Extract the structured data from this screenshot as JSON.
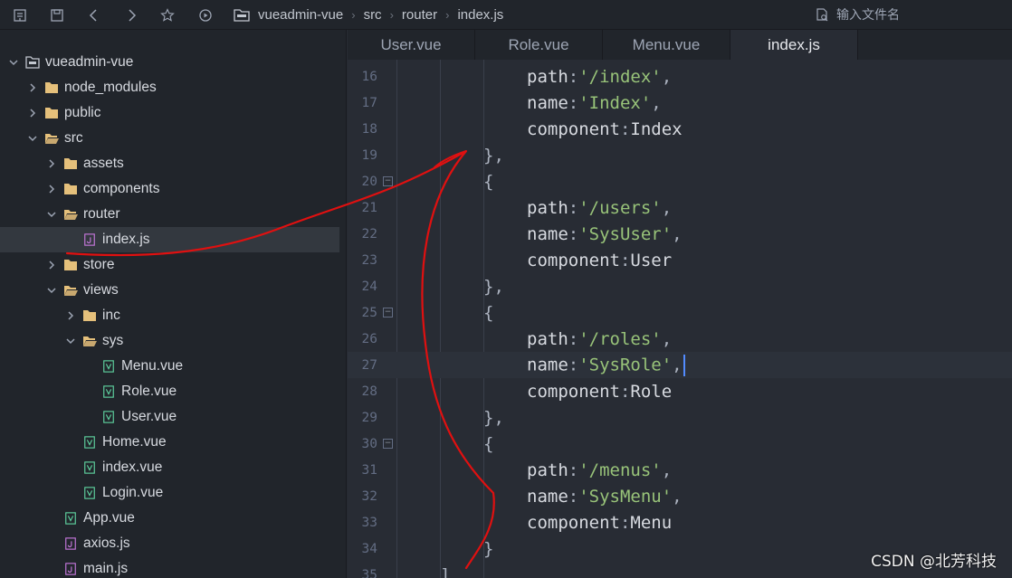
{
  "toolbar": {
    "icons": [
      "collapse-icon",
      "save-icon",
      "back-icon",
      "forward-icon",
      "star-icon",
      "run-icon"
    ]
  },
  "breadcrumb": {
    "items": [
      "vueadmin-vue",
      "src",
      "router",
      "index.js"
    ]
  },
  "file_search": {
    "placeholder": "输入文件名"
  },
  "tabs": [
    {
      "label": "User.vue",
      "active": false
    },
    {
      "label": "Role.vue",
      "active": false
    },
    {
      "label": "Menu.vue",
      "active": false
    },
    {
      "label": "index.js",
      "active": true
    }
  ],
  "tree": [
    {
      "label": "vueadmin-vue",
      "depth": 0,
      "type": "project",
      "expanded": true
    },
    {
      "label": "node_modules",
      "depth": 1,
      "type": "folder",
      "expanded": false
    },
    {
      "label": "public",
      "depth": 1,
      "type": "folder",
      "expanded": false
    },
    {
      "label": "src",
      "depth": 1,
      "type": "folder",
      "expanded": true
    },
    {
      "label": "assets",
      "depth": 2,
      "type": "folder",
      "expanded": false
    },
    {
      "label": "components",
      "depth": 2,
      "type": "folder",
      "expanded": false
    },
    {
      "label": "router",
      "depth": 2,
      "type": "folder",
      "expanded": true
    },
    {
      "label": "index.js",
      "depth": 3,
      "type": "js",
      "selected": true
    },
    {
      "label": "store",
      "depth": 2,
      "type": "folder",
      "expanded": false
    },
    {
      "label": "views",
      "depth": 2,
      "type": "folder",
      "expanded": true
    },
    {
      "label": "inc",
      "depth": 3,
      "type": "folder",
      "expanded": false
    },
    {
      "label": "sys",
      "depth": 3,
      "type": "folder",
      "expanded": true
    },
    {
      "label": "Menu.vue",
      "depth": 4,
      "type": "vue"
    },
    {
      "label": "Role.vue",
      "depth": 4,
      "type": "vue"
    },
    {
      "label": "User.vue",
      "depth": 4,
      "type": "vue"
    },
    {
      "label": "Home.vue",
      "depth": 3,
      "type": "vue"
    },
    {
      "label": "index.vue",
      "depth": 3,
      "type": "vue"
    },
    {
      "label": "Login.vue",
      "depth": 3,
      "type": "vue"
    },
    {
      "label": "App.vue",
      "depth": 2,
      "type": "vue"
    },
    {
      "label": "axios.js",
      "depth": 2,
      "type": "js"
    },
    {
      "label": "main.js",
      "depth": 2,
      "type": "js"
    }
  ],
  "code": [
    {
      "n": "16",
      "indent": 3,
      "tokens": [
        [
          "key",
          "path"
        ],
        [
          "pun",
          ":"
        ],
        [
          "str",
          "'/index'"
        ],
        [
          "pun",
          ","
        ]
      ]
    },
    {
      "n": "17",
      "indent": 3,
      "tokens": [
        [
          "key",
          "name"
        ],
        [
          "pun",
          ":"
        ],
        [
          "str",
          "'Index'"
        ],
        [
          "pun",
          ","
        ]
      ]
    },
    {
      "n": "18",
      "indent": 3,
      "tokens": [
        [
          "key",
          "component"
        ],
        [
          "pun",
          ":"
        ],
        [
          "id",
          "Index"
        ]
      ]
    },
    {
      "n": "19",
      "indent": 2,
      "tokens": [
        [
          "pun",
          "},"
        ]
      ]
    },
    {
      "n": "20",
      "indent": 2,
      "fold": true,
      "tokens": [
        [
          "pun",
          "{"
        ]
      ]
    },
    {
      "n": "21",
      "indent": 3,
      "tokens": [
        [
          "key",
          "path"
        ],
        [
          "pun",
          ":"
        ],
        [
          "str",
          "'/users'"
        ],
        [
          "pun",
          ","
        ]
      ]
    },
    {
      "n": "22",
      "indent": 3,
      "tokens": [
        [
          "key",
          "name"
        ],
        [
          "pun",
          ":"
        ],
        [
          "str",
          "'SysUser'"
        ],
        [
          "pun",
          ","
        ]
      ]
    },
    {
      "n": "23",
      "indent": 3,
      "tokens": [
        [
          "key",
          "component"
        ],
        [
          "pun",
          ":"
        ],
        [
          "id",
          "User"
        ]
      ]
    },
    {
      "n": "24",
      "indent": 2,
      "tokens": [
        [
          "pun",
          "},"
        ]
      ]
    },
    {
      "n": "25",
      "indent": 2,
      "fold": true,
      "tokens": [
        [
          "pun",
          "{"
        ]
      ]
    },
    {
      "n": "26",
      "indent": 3,
      "tokens": [
        [
          "key",
          "path"
        ],
        [
          "pun",
          ":"
        ],
        [
          "str",
          "'/roles'"
        ],
        [
          "pun",
          ","
        ]
      ]
    },
    {
      "n": "27",
      "indent": 3,
      "current": true,
      "tokens": [
        [
          "key",
          "name"
        ],
        [
          "pun",
          ":"
        ],
        [
          "str",
          "'SysRole'"
        ],
        [
          "pun",
          ","
        ]
      ]
    },
    {
      "n": "28",
      "indent": 3,
      "tokens": [
        [
          "key",
          "component"
        ],
        [
          "pun",
          ":"
        ],
        [
          "id",
          "Role"
        ]
      ]
    },
    {
      "n": "29",
      "indent": 2,
      "tokens": [
        [
          "pun",
          "},"
        ]
      ]
    },
    {
      "n": "30",
      "indent": 2,
      "fold": true,
      "tokens": [
        [
          "pun",
          "{"
        ]
      ]
    },
    {
      "n": "31",
      "indent": 3,
      "tokens": [
        [
          "key",
          "path"
        ],
        [
          "pun",
          ":"
        ],
        [
          "str",
          "'/menus'"
        ],
        [
          "pun",
          ","
        ]
      ]
    },
    {
      "n": "32",
      "indent": 3,
      "tokens": [
        [
          "key",
          "name"
        ],
        [
          "pun",
          ":"
        ],
        [
          "str",
          "'SysMenu'"
        ],
        [
          "pun",
          ","
        ]
      ]
    },
    {
      "n": "33",
      "indent": 3,
      "tokens": [
        [
          "key",
          "component"
        ],
        [
          "pun",
          ":"
        ],
        [
          "id",
          "Menu"
        ]
      ]
    },
    {
      "n": "34",
      "indent": 2,
      "tokens": [
        [
          "pun",
          "}"
        ]
      ]
    },
    {
      "n": "35",
      "indent": 1,
      "tokens": [
        [
          "pun",
          "]"
        ]
      ]
    }
  ],
  "watermark": "CSDN @北芳科技",
  "colors": {
    "string": "#98c379",
    "folder": "#e5c07b",
    "vue_icon": "#5fd3a0",
    "js_icon": "#c678dd",
    "annotation": "#e01010"
  }
}
